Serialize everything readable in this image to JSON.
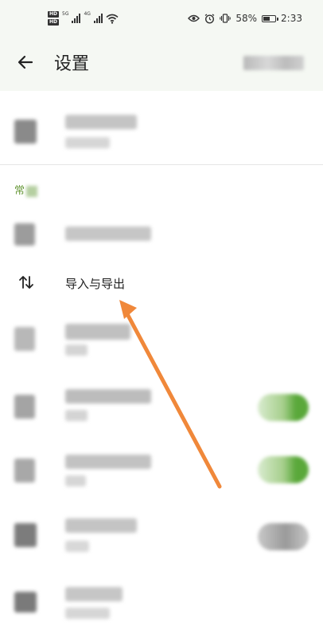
{
  "status_bar": {
    "battery": "58%",
    "battery_level": 0.58,
    "time": "2:33",
    "hd_badge": "HD",
    "net_5g": "5G",
    "net_4g": "4G"
  },
  "app_bar": {
    "title": "设置"
  },
  "section": {
    "header": "常"
  },
  "rows": {
    "import_export": "导入与导出"
  },
  "colors": {
    "accent": "#6a9a3c",
    "annotation_arrow": "#f0883a",
    "toggle_on": "#5aa83a",
    "toggle_off": "#9a9a9a"
  },
  "icons": {
    "back": "arrow-left-icon",
    "import_export": "swap-vertical-icon"
  }
}
